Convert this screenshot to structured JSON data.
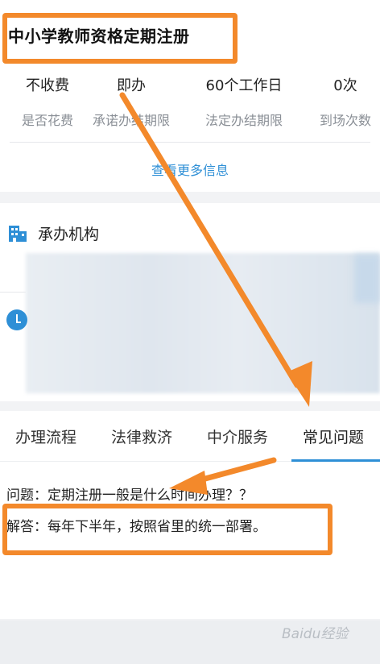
{
  "header": {
    "title": "中小学教师资格定期注册"
  },
  "stats": [
    {
      "value": "不收费",
      "label": "是否花费"
    },
    {
      "value": "即办",
      "label": "承诺办结期限"
    },
    {
      "value": "60个工作日",
      "label": "法定办结期限"
    },
    {
      "value": "0次",
      "label": "到场次数"
    }
  ],
  "more_info": "查看更多信息",
  "org": {
    "title": "承办机构"
  },
  "tabs": [
    {
      "label": "办理流程"
    },
    {
      "label": "法律救济"
    },
    {
      "label": "中介服务"
    },
    {
      "label": "常见问题"
    }
  ],
  "active_tab": "常见问题",
  "faq": {
    "question": "问题：定期注册一般是什么时间办理？？",
    "answer": "解答：每年下半年，按照省里的统一部署。"
  },
  "annotation_color": "#f3892b",
  "accent_color": "#2e8fd6",
  "watermark": "Baidu经验"
}
